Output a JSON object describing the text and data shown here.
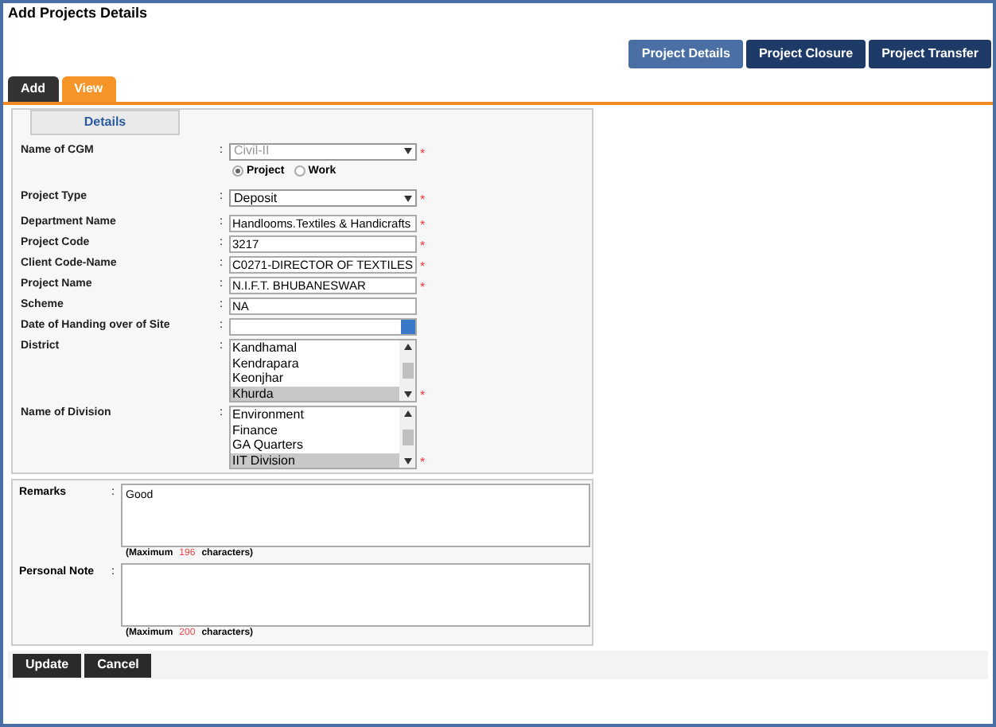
{
  "page_title": "Add Projects Details",
  "top_buttons": [
    {
      "label": "Project Details",
      "selected": true
    },
    {
      "label": "Project Closure",
      "selected": false
    },
    {
      "label": "Project Transfer",
      "selected": false
    }
  ],
  "tabs": [
    {
      "label": "Add",
      "selected": false
    },
    {
      "label": "View",
      "selected": true
    }
  ],
  "section_tab": "Details",
  "fields": [
    {
      "kind": "select",
      "label": "Name of CGM",
      "separator": ":",
      "value": "Civil-II",
      "disabled": true,
      "required_mark": "*"
    },
    {
      "kind": "radios",
      "options": [
        {
          "label": "Project",
          "selected": true
        },
        {
          "label": "Work",
          "selected": false
        }
      ]
    },
    {
      "kind": "select",
      "label": "Project Type",
      "separator": ":",
      "value": "Deposit",
      "disabled": false,
      "required_mark": "*"
    },
    {
      "kind": "text",
      "label": "Department Name",
      "separator": ":",
      "value": "Handlooms.Textiles & Handicrafts",
      "required_mark": "*"
    },
    {
      "kind": "text",
      "label": "Project Code",
      "separator": ":",
      "value": "3217",
      "required_mark": "*"
    },
    {
      "kind": "text",
      "label": "Client Code-Name",
      "separator": ":",
      "value": "C0271-DIRECTOR OF TEXTILES",
      "required_mark": "*"
    },
    {
      "kind": "text",
      "label": "Project Name",
      "separator": ":",
      "value": "N.I.F.T. BHUBANESWAR",
      "required_mark": "*"
    },
    {
      "kind": "text",
      "label": "Scheme",
      "separator": ":",
      "value": "NA"
    },
    {
      "kind": "date",
      "label": "Date of Handing over of Site",
      "separator": ":"
    },
    {
      "kind": "listbox",
      "label": "District",
      "separator": ":",
      "required_mark": "*",
      "items": [
        {
          "label": "Kandhamal",
          "selected": false
        },
        {
          "label": "Kendrapara",
          "selected": false
        },
        {
          "label": "Keonjhar",
          "selected": false
        },
        {
          "label": "Khurda",
          "selected": true
        }
      ]
    },
    {
      "kind": "listbox",
      "label": "Name of Division",
      "separator": ":",
      "required_mark": "*",
      "items": [
        {
          "label": "Environment",
          "selected": false
        },
        {
          "label": "Finance",
          "selected": false
        },
        {
          "label": "GA Quarters",
          "selected": false
        },
        {
          "label": "IIT Division",
          "selected": true
        }
      ]
    }
  ],
  "notes": [
    {
      "label": "Remarks",
      "separator": ":",
      "value": "Good",
      "max_prefix": "(Maximum",
      "max_count": "196",
      "max_suffix": "characters)"
    },
    {
      "label": "Personal Note",
      "separator": ":",
      "max_prefix": "(Maximum",
      "max_count": "200",
      "max_suffix": "characters)"
    }
  ],
  "buttons": [
    "Update",
    "Cancel"
  ]
}
